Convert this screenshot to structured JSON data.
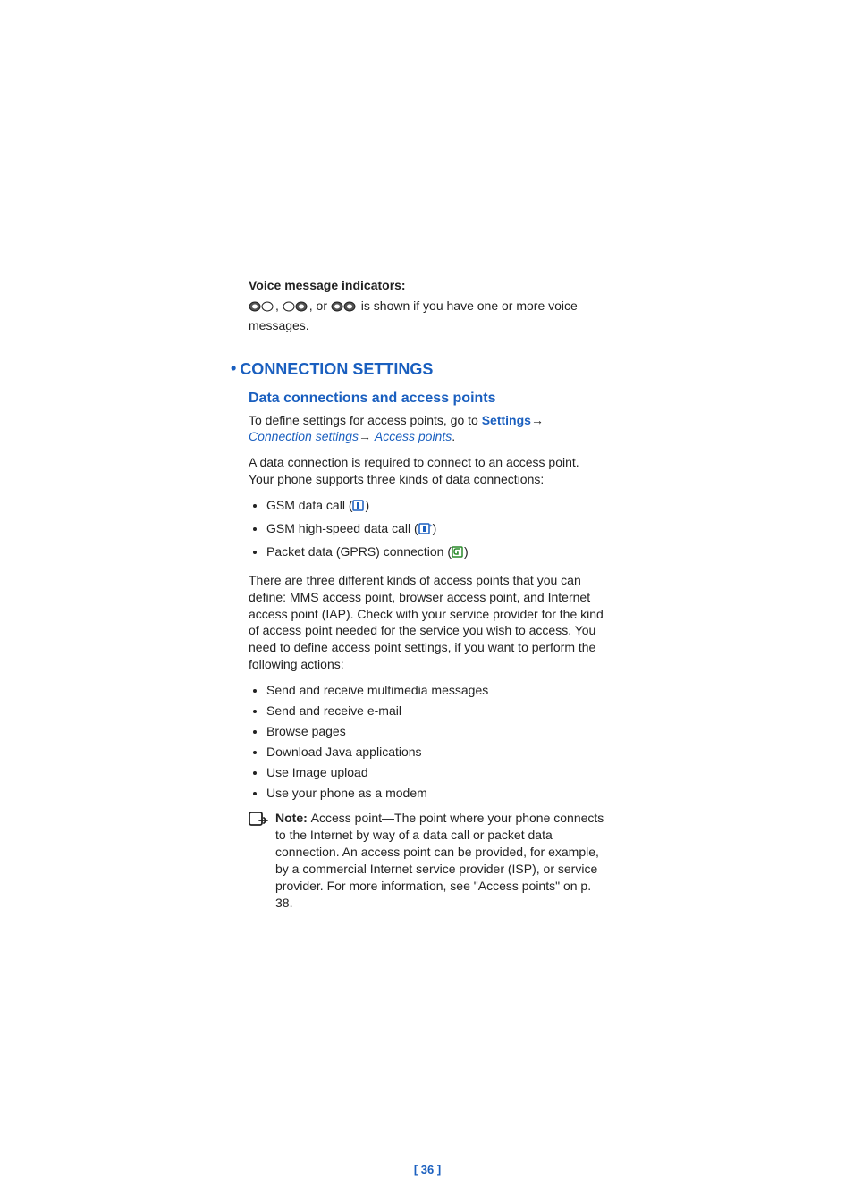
{
  "voice_label": "Voice message indicators:",
  "voice_tail": " is shown if you have one or more voice messages.",
  "voice_sep1": ", ",
  "voice_sep2": ", or ",
  "section_title": "CONNECTION SETTINGS",
  "sub_title": "Data connections and access points",
  "define_prefix": "To define settings for access points, go to ",
  "link_settings": "Settings",
  "link_conn": "Connection settings",
  "link_ap": "Access points",
  "arrow": "→ ",
  "arrow2": "→",
  "period": ".",
  "para_conn": "A data connection is required to connect to an access point. Your phone supports three kinds of data connections:",
  "conn_list": {
    "0": {
      "pre": "GSM data call (",
      "post": ")"
    },
    "1": {
      "pre": "GSM high-speed data call (",
      "post": ")"
    },
    "2": {
      "pre": "Packet data (GPRS) connection (",
      "post": ")"
    }
  },
  "para_ap": "There are three different kinds of access points that you can define: MMS access point, browser access point, and Internet access point (IAP). Check with your service provider for the kind of access point needed for the service you wish to access. You need to define access point settings, if you want to perform the following actions:",
  "action_list": {
    "0": "Send and receive multimedia messages",
    "1": "Send and receive e-mail",
    "2": "Browse pages",
    "3": "Download Java applications",
    "4": "Use Image upload",
    "5": "Use your phone as a modem"
  },
  "note_label": "Note: ",
  "note_body": "Access point—The point where your phone connects to the Internet by way of a data call or packet data connection. An access point can be provided, for example, by a commercial Internet service provider (ISP), or service provider. For more information, see \"Access points\" on p. 38.",
  "page_number": "[ 36 ]"
}
